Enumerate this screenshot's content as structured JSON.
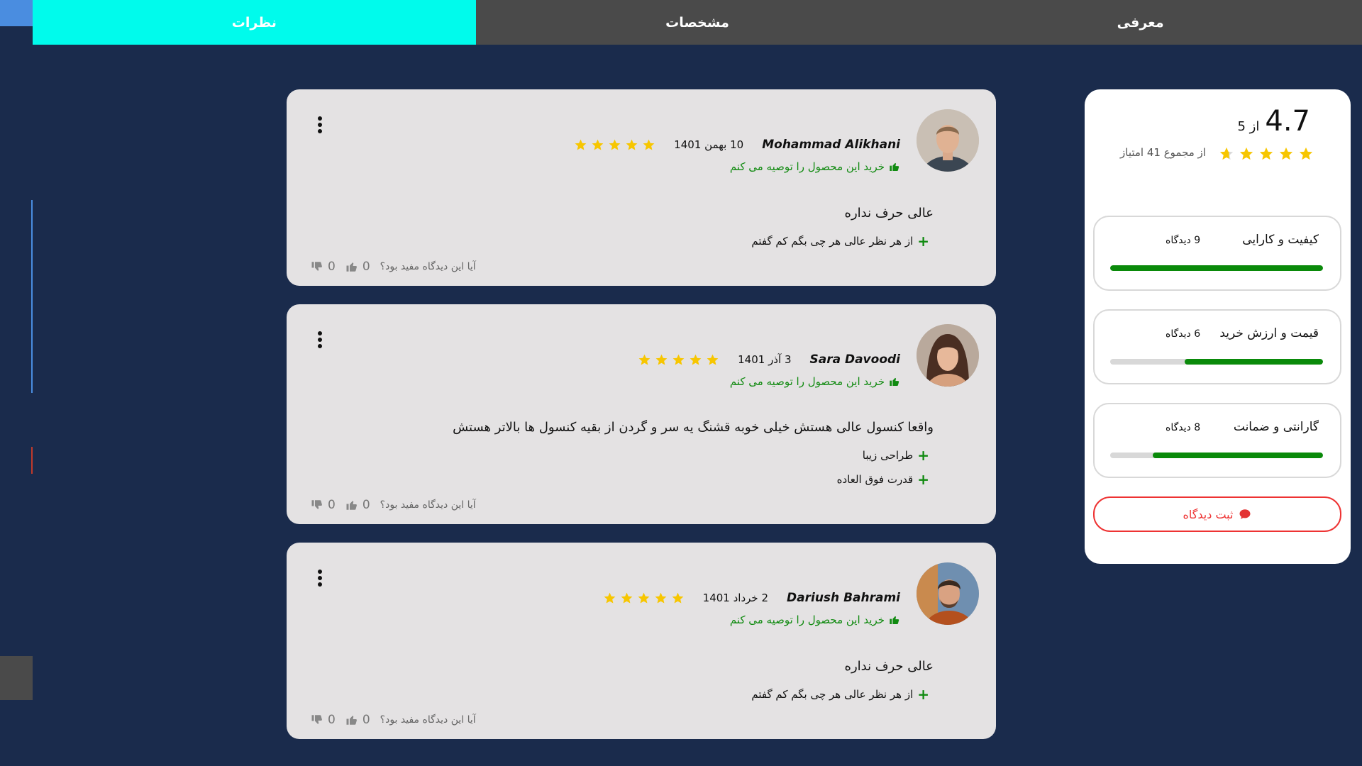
{
  "tabs": [
    {
      "label": "معرفی",
      "active": false
    },
    {
      "label": "مشخصات",
      "active": false
    },
    {
      "label": "نظرات",
      "active": true
    }
  ],
  "summary": {
    "score": "4.7",
    "out_of": "از 5",
    "stars_filled": 4.7,
    "total_text": "از مجموع 41 امتیاز",
    "ratings": [
      {
        "title": "کیفیت و کارایی",
        "count": "9 دیدگاه",
        "fill": 1.0
      },
      {
        "title": "قیمت و ارزش خرید",
        "count": "6 دیدگاه",
        "fill": 0.65
      },
      {
        "title": "گارانتی و ضمانت",
        "count": "8 دیدگاه",
        "fill": 0.8
      }
    ],
    "submit_label": "ثبت دیدگاه"
  },
  "reviews": [
    {
      "author": "Mohammad Alikhani",
      "date": "10 بهمن 1401",
      "stars": 5,
      "recommend": "خرید این محصول را توصیه می کنم",
      "text": "عالی حرف نداره",
      "pros": [
        "از هر نظر عالی هر چی بگم کم گفتم"
      ],
      "helpful_question": "آیا این دیدگاه مفید بود؟",
      "likes": "0",
      "dislikes": "0"
    },
    {
      "author": "Sara Davoodi",
      "date": "3 آذر 1401",
      "stars": 5,
      "recommend": "خرید این محصول را توصیه می کنم",
      "text": "واقعا کنسول عالی هستش خیلی خوبه قشنگ یه سر و گردن از بقیه کنسول ها بالاتر هستش",
      "pros": [
        "طراحی زیبا",
        "قدرت فوق العاده"
      ],
      "helpful_question": "آیا این دیدگاه مفید بود؟",
      "likes": "0",
      "dislikes": "0"
    },
    {
      "author": "Dariush Bahrami",
      "date": "2 خرداد 1401",
      "stars": 5,
      "recommend": "خرید این محصول را توصیه می کنم",
      "text": "عالی حرف نداره",
      "pros": [
        "از هر نظر عالی هر چی بگم کم گفتم"
      ],
      "helpful_question": "آیا این دیدگاه مفید بود؟",
      "likes": "0",
      "dislikes": "0"
    }
  ],
  "colors": {
    "background": "#1a2b4c",
    "tab_active": "#00fbec",
    "tab_bar": "#4a4a4a",
    "star": "#f7c600",
    "progress": "#0a8a0a",
    "recommend": "#108a10",
    "submit": "#e33333"
  },
  "icons": {
    "star": "star-icon",
    "thumbs_up": "thumbs-up-icon",
    "thumbs_down": "thumbs-down-icon",
    "comment": "comment-icon",
    "menu": "more-vertical-icon"
  }
}
